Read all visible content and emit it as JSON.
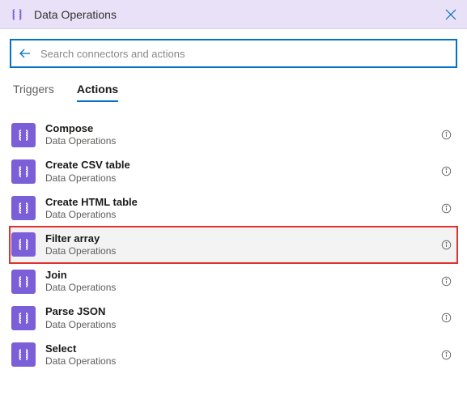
{
  "header": {
    "title": "Data Operations"
  },
  "search": {
    "placeholder": "Search connectors and actions",
    "value": ""
  },
  "tabs": {
    "triggers": "Triggers",
    "actions": "Actions",
    "active": "actions"
  },
  "actions": [
    {
      "title": "Compose",
      "subtitle": "Data Operations",
      "highlighted": false
    },
    {
      "title": "Create CSV table",
      "subtitle": "Data Operations",
      "highlighted": false
    },
    {
      "title": "Create HTML table",
      "subtitle": "Data Operations",
      "highlighted": false
    },
    {
      "title": "Filter array",
      "subtitle": "Data Operations",
      "highlighted": true
    },
    {
      "title": "Join",
      "subtitle": "Data Operations",
      "highlighted": false
    },
    {
      "title": "Parse JSON",
      "subtitle": "Data Operations",
      "highlighted": false
    },
    {
      "title": "Select",
      "subtitle": "Data Operations",
      "highlighted": false
    }
  ],
  "colors": {
    "accent": "#0372c6",
    "connector": "#7b5fd9",
    "highlight_border": "#e0322f",
    "header_bg": "#e9e1f7"
  }
}
